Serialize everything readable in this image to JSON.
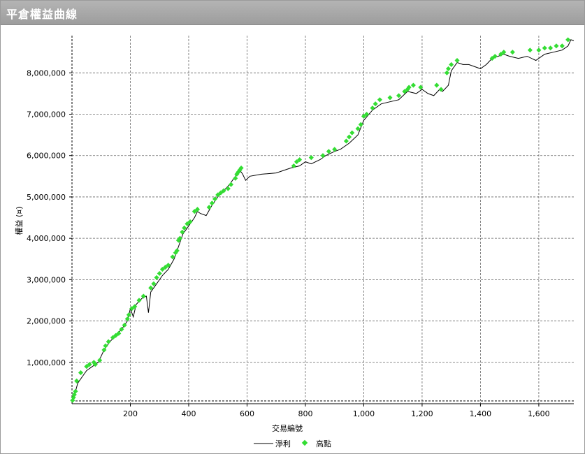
{
  "window": {
    "title": "平倉權益曲線"
  },
  "chart_data": {
    "type": "line",
    "xlabel": "交易編號",
    "ylabel": "權益 (¤)",
    "xlim": [
      0,
      1720
    ],
    "ylim": [
      0,
      8900000
    ],
    "xticks": [
      200,
      400,
      600,
      800,
      1000,
      1200,
      1400,
      1600
    ],
    "xtick_labels": [
      "200",
      "400",
      "600",
      "800",
      "1,000",
      "1,200",
      "1,400",
      "1,600"
    ],
    "yticks": [
      1000000,
      2000000,
      3000000,
      4000000,
      5000000,
      6000000,
      7000000,
      8000000
    ],
    "ytick_labels": [
      "1,000,000",
      "2,000,000",
      "3,000,000",
      "4,000,000",
      "5,000,000",
      "6,000,000",
      "7,000,000",
      "8,000,000"
    ],
    "grid": true,
    "legend": "bottom-center",
    "series": [
      {
        "name": "淨利",
        "color": "#000000",
        "x": [
          0,
          10,
          20,
          35,
          50,
          70,
          90,
          110,
          130,
          150,
          170,
          190,
          200,
          210,
          220,
          240,
          255,
          262,
          270,
          290,
          310,
          330,
          350,
          360,
          370,
          380,
          400,
          420,
          430,
          440,
          460,
          480,
          500,
          520,
          540,
          560,
          575,
          585,
          595,
          610,
          650,
          700,
          750,
          780,
          800,
          820,
          850,
          870,
          900,
          920,
          950,
          980,
          1000,
          1030,
          1060,
          1090,
          1120,
          1150,
          1180,
          1200,
          1220,
          1240,
          1260,
          1270,
          1290,
          1300,
          1320,
          1340,
          1360,
          1380,
          1400,
          1420,
          1440,
          1460,
          1480,
          1500,
          1530,
          1560,
          1590,
          1620,
          1650,
          1680,
          1700,
          1710,
          1720
        ],
        "y": [
          50000,
          250000,
          500000,
          650000,
          800000,
          900000,
          1000000,
          1300000,
          1500000,
          1650000,
          1800000,
          2000000,
          2300000,
          2100000,
          2400000,
          2550000,
          2600000,
          2200000,
          2700000,
          2900000,
          3100000,
          3250000,
          3500000,
          3700000,
          3900000,
          4100000,
          4300000,
          4500000,
          4650000,
          4600000,
          4550000,
          4800000,
          5000000,
          5150000,
          5300000,
          5500000,
          5650000,
          5550000,
          5400000,
          5500000,
          5550000,
          5580000,
          5700000,
          5750000,
          5850000,
          5800000,
          5900000,
          6000000,
          6100000,
          6150000,
          6300000,
          6500000,
          6850000,
          7100000,
          7250000,
          7300000,
          7350000,
          7550000,
          7500000,
          7600000,
          7500000,
          7450000,
          7600000,
          7550000,
          7700000,
          8050000,
          8250000,
          8200000,
          8200000,
          8150000,
          8100000,
          8200000,
          8350000,
          8400000,
          8450000,
          8400000,
          8350000,
          8400000,
          8300000,
          8450000,
          8500000,
          8550000,
          8650000,
          8800000,
          8780000
        ]
      },
      {
        "name": "高點",
        "color": "#33dd33",
        "x": [
          2,
          5,
          8,
          12,
          16,
          30,
          50,
          60,
          75,
          80,
          95,
          110,
          115,
          125,
          140,
          150,
          160,
          170,
          180,
          190,
          195,
          205,
          215,
          230,
          245,
          270,
          280,
          290,
          300,
          310,
          320,
          330,
          345,
          355,
          360,
          365,
          370,
          378,
          385,
          395,
          405,
          420,
          430,
          470,
          480,
          490,
          500,
          510,
          520,
          535,
          545,
          560,
          565,
          570,
          575,
          580,
          760,
          770,
          780,
          820,
          860,
          880,
          900,
          940,
          950,
          960,
          980,
          990,
          1000,
          1010,
          1030,
          1040,
          1055,
          1090,
          1120,
          1140,
          1150,
          1155,
          1170,
          1195,
          1250,
          1265,
          1285,
          1290,
          1300,
          1320,
          1440,
          1450,
          1470,
          1480,
          1510,
          1570,
          1600,
          1620,
          1640,
          1660,
          1680,
          1700
        ],
        "y": [
          80000,
          150000,
          220000,
          300000,
          550000,
          750000,
          900000,
          950000,
          1000000,
          950000,
          1050000,
          1300000,
          1400000,
          1500000,
          1600000,
          1650000,
          1700000,
          1800000,
          1900000,
          2050000,
          2150000,
          2300000,
          2350000,
          2500000,
          2600000,
          2800000,
          2900000,
          3050000,
          3150000,
          3250000,
          3300000,
          3350000,
          3550000,
          3650000,
          3700000,
          3950000,
          4000000,
          4150000,
          4250000,
          4350000,
          4400000,
          4650000,
          4700000,
          4750000,
          4850000,
          4950000,
          5050000,
          5100000,
          5150000,
          5200000,
          5300000,
          5450000,
          5550000,
          5600000,
          5650000,
          5700000,
          5750000,
          5850000,
          5900000,
          5950000,
          6000000,
          6100000,
          6150000,
          6350000,
          6450000,
          6550000,
          6650000,
          6750000,
          6950000,
          7000000,
          7150000,
          7250000,
          7350000,
          7400000,
          7450000,
          7550000,
          7600000,
          7650000,
          7700000,
          7650000,
          7700000,
          7600000,
          8000000,
          8100000,
          8200000,
          8300000,
          8350000,
          8400000,
          8450000,
          8500000,
          8500000,
          8550000,
          8550000,
          8600000,
          8600000,
          8650000,
          8650000,
          8800000
        ]
      }
    ]
  }
}
